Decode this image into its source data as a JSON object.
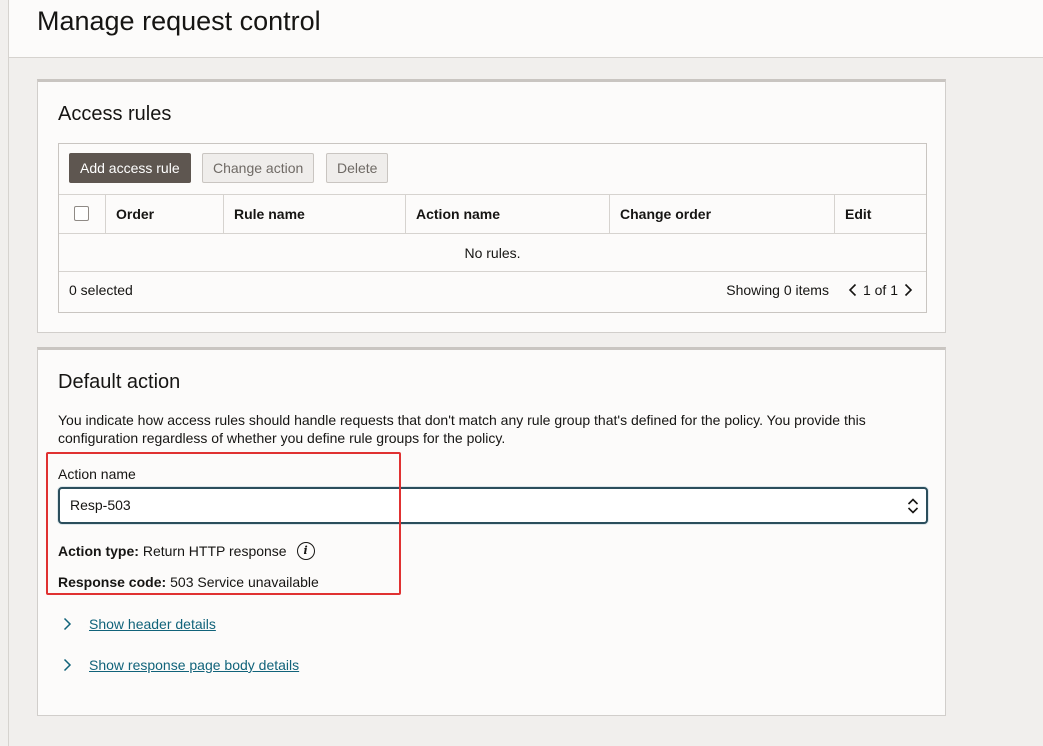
{
  "page": {
    "title": "Manage request control"
  },
  "access_rules": {
    "title": "Access rules",
    "buttons": {
      "add": "Add access rule",
      "change": "Change action",
      "delete": "Delete"
    },
    "columns": [
      "Order",
      "Rule name",
      "Action name",
      "Change order",
      "Edit"
    ],
    "empty_message": "No rules.",
    "selected_count": "0 selected",
    "showing": "Showing 0 items",
    "page_info": "1 of 1"
  },
  "default_action": {
    "title": "Default action",
    "description": "You indicate how access rules should handle requests that don't match any rule group that's defined for the policy. You provide this configuration regardless of whether you define rule groups for the policy.",
    "action_name_label": "Action name",
    "action_name_value": "Resp-503",
    "action_type_label": "Action type:",
    "action_type_value": "Return HTTP response",
    "response_code_label": "Response code:",
    "response_code_value": "503 Service unavailable",
    "show_header_link": "Show header details",
    "show_body_link": "Show response page body details"
  },
  "colors": {
    "primary_button": "#5e5650",
    "link": "#11637a",
    "highlight": "#e03131",
    "focus_border": "#2b4e5c"
  }
}
